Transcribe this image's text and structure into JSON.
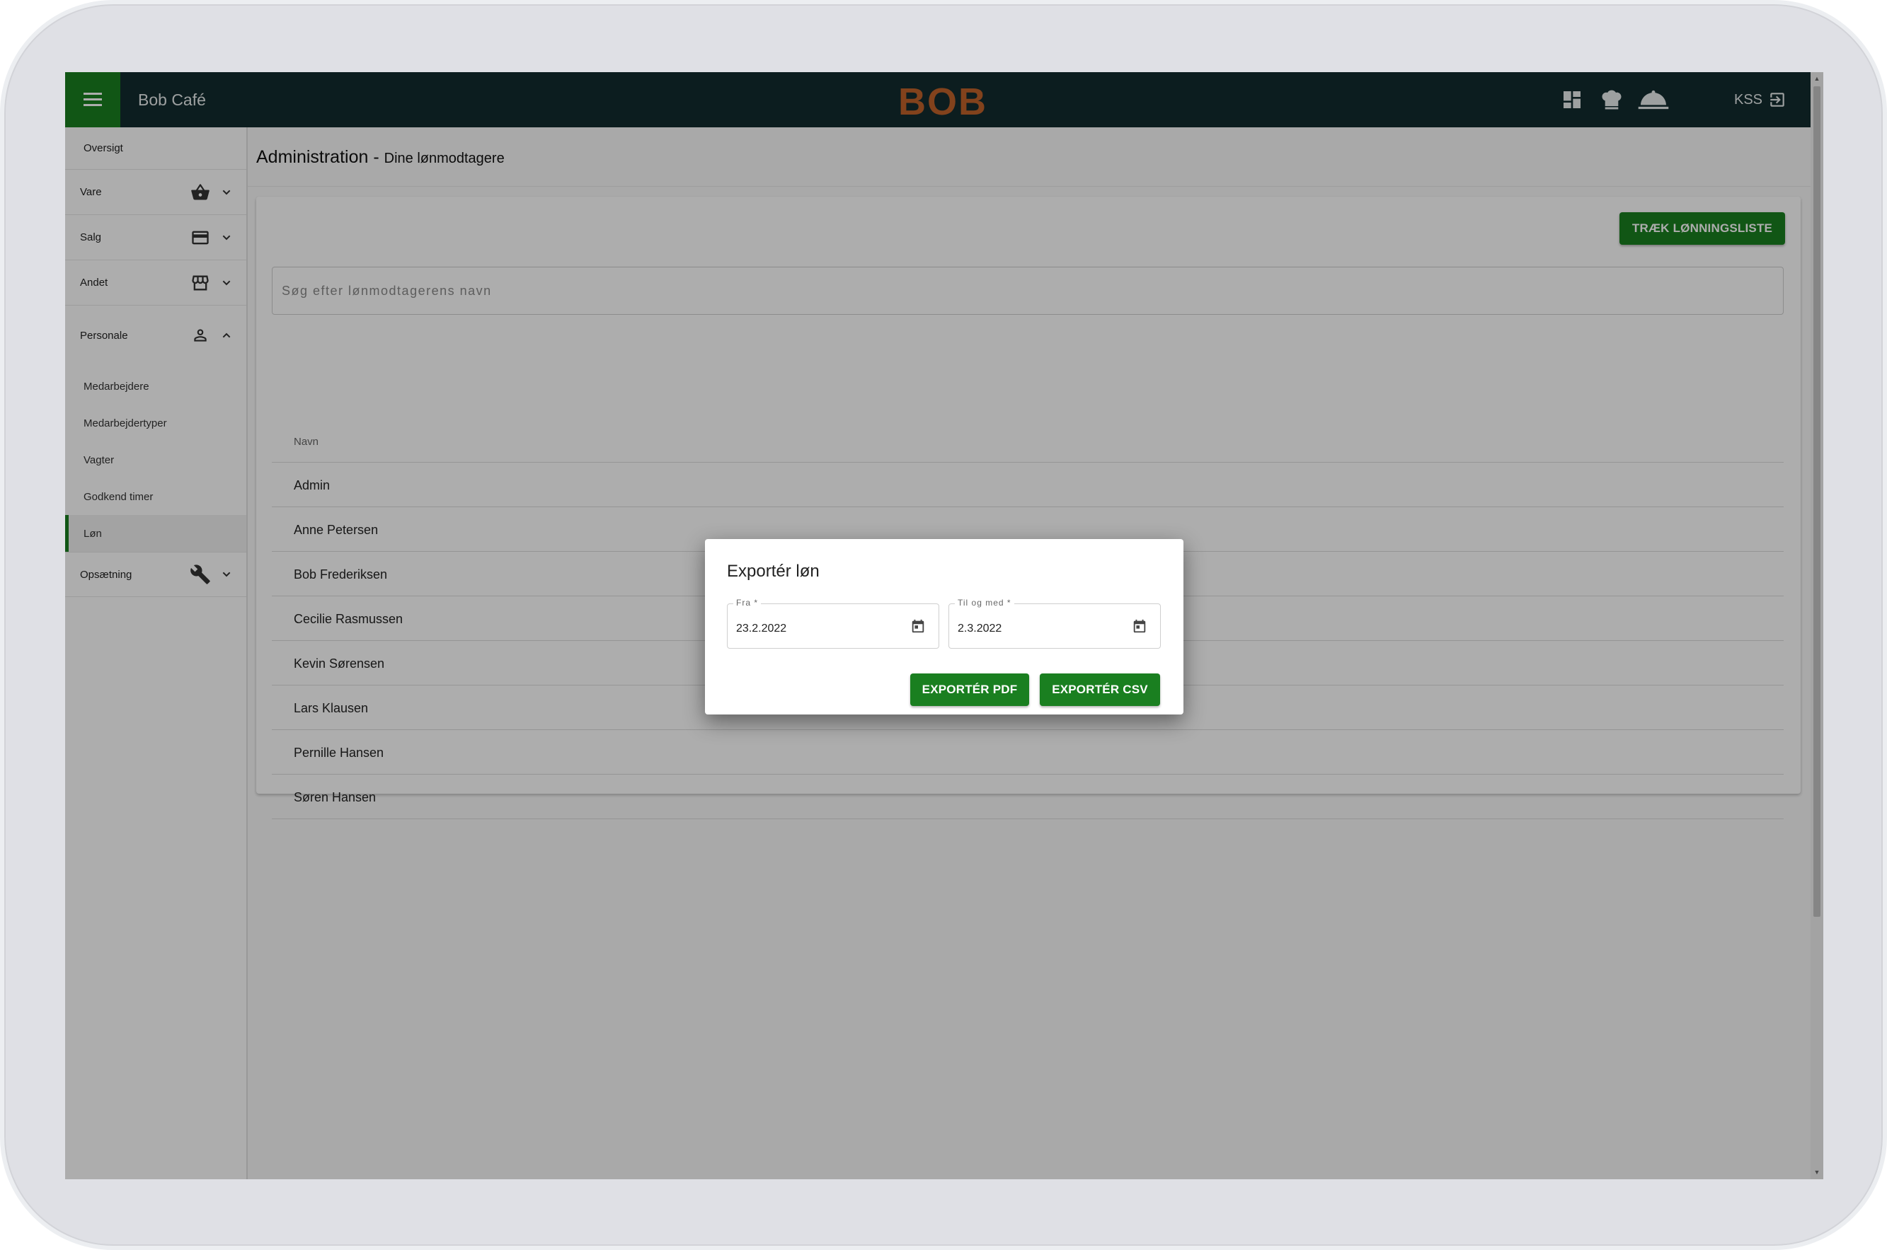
{
  "header": {
    "app_title": "Bob Café",
    "logo_text": "BOB",
    "user": "KSS"
  },
  "colors": {
    "brand_green": "#1a7f20",
    "topbar_bg": "#122b2f",
    "logo_orange": "#c0622a"
  },
  "sidebar": {
    "items": [
      {
        "label": "Oversigt"
      },
      {
        "label": "Vare",
        "icon": "basket-icon"
      },
      {
        "label": "Salg",
        "icon": "credit-card-icon"
      },
      {
        "label": "Andet",
        "icon": "store-icon"
      },
      {
        "label": "Personale",
        "icon": "person-icon"
      },
      {
        "label": "Opsætning",
        "icon": "wrench-icon"
      }
    ],
    "personale_sub": [
      {
        "label": "Medarbejdere"
      },
      {
        "label": "Medarbejdertyper"
      },
      {
        "label": "Vagter"
      },
      {
        "label": "Godkend timer"
      },
      {
        "label": "Løn"
      }
    ]
  },
  "page": {
    "title": "Administration -",
    "subtitle": "Dine lønmodtagere",
    "payroll_button": "TRÆK LØNNINGSLISTE",
    "search_placeholder": "Søg efter lønmodtagerens navn"
  },
  "table": {
    "header": "Navn",
    "rows": [
      "Admin",
      "Anne Petersen",
      "Bob Frederiksen",
      "Cecilie Rasmussen",
      "Kevin Sørensen",
      "Lars Klausen",
      "Pernille Hansen",
      "Søren Hansen"
    ]
  },
  "dialog": {
    "title": "Exportér løn",
    "from_label": "Fra *",
    "from_value": "23.2.2022",
    "to_label": "Til og med *",
    "to_value": "2.3.2022",
    "export_pdf": "EXPORTÉR PDF",
    "export_csv": "EXPORTÉR CSV"
  }
}
